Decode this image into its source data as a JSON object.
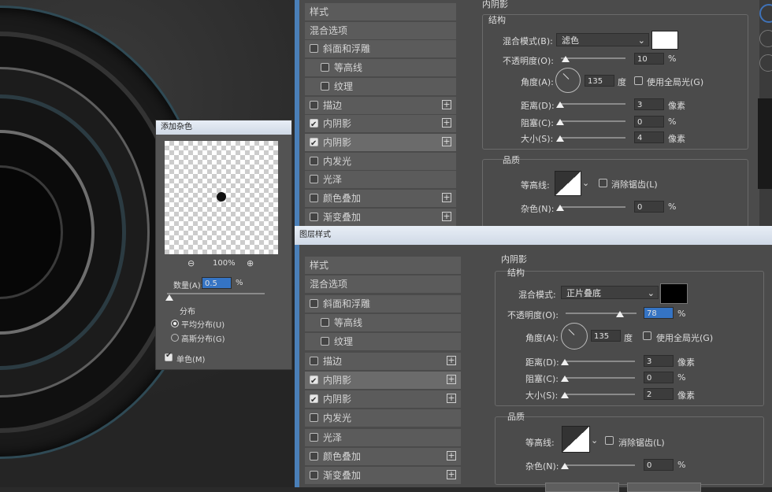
{
  "noise_dialog": {
    "title": "添加杂色",
    "zoom": "100%",
    "amount_label": "数量(A):",
    "amount_value": "0.5",
    "amount_unit": "%",
    "distribution_label": "分布",
    "uniform_label": "平均分布(U)",
    "gaussian_label": "高斯分布(G)",
    "mono_label": "单色(M)",
    "zoom_out": "⊖",
    "zoom_in": "⊕"
  },
  "top_panel": {
    "list": [
      {
        "label": "样式",
        "check": false,
        "checked": false,
        "plus": false,
        "indent": 0
      },
      {
        "label": "混合选项",
        "check": false,
        "checked": false,
        "plus": false,
        "indent": 0
      },
      {
        "label": "斜面和浮雕",
        "check": true,
        "checked": false,
        "plus": false,
        "indent": 0
      },
      {
        "label": "等高线",
        "check": true,
        "checked": false,
        "plus": false,
        "indent": 1
      },
      {
        "label": "纹理",
        "check": true,
        "checked": false,
        "plus": false,
        "indent": 1
      },
      {
        "label": "描边",
        "check": true,
        "checked": false,
        "plus": true,
        "indent": 0
      },
      {
        "label": "内阴影",
        "check": true,
        "checked": true,
        "plus": true,
        "indent": 0
      },
      {
        "label": "内阴影",
        "check": true,
        "checked": true,
        "plus": true,
        "indent": 0,
        "highlight": true
      },
      {
        "label": "内发光",
        "check": true,
        "checked": false,
        "plus": false,
        "indent": 0
      },
      {
        "label": "光泽",
        "check": true,
        "checked": false,
        "plus": false,
        "indent": 0
      },
      {
        "label": "颜色叠加",
        "check": true,
        "checked": false,
        "plus": true,
        "indent": 0
      },
      {
        "label": "渐变叠加",
        "check": true,
        "checked": false,
        "plus": true,
        "indent": 0
      }
    ],
    "section_title": "内阴影",
    "structure": "结构",
    "blend_label": "混合模式(B):",
    "blend_value": "滤色",
    "opacity_label": "不透明度(O):",
    "opacity_value": "10",
    "angle_label": "角度(A):",
    "angle_value": "135",
    "degree": "度",
    "global_light": "使用全局光(G)",
    "distance_label": "距离(D):",
    "distance_value": "3",
    "choke_label": "阻塞(C):",
    "choke_value": "0",
    "size_label": "大小(S):",
    "size_value": "4",
    "quality": "品质",
    "contour_label": "等高线:",
    "antialias": "消除锯齿(L)",
    "noise_label": "杂色(N):",
    "noise_value": "0",
    "pct": "%",
    "px": "像素",
    "blend_color": "#ffffff"
  },
  "bottom_panel": {
    "title": "图层样式",
    "list": [
      {
        "label": "样式",
        "check": false,
        "checked": false,
        "plus": false,
        "indent": 0
      },
      {
        "label": "混合选项",
        "check": false,
        "checked": false,
        "plus": false,
        "indent": 0
      },
      {
        "label": "斜面和浮雕",
        "check": true,
        "checked": false,
        "plus": false,
        "indent": 0
      },
      {
        "label": "等高线",
        "check": true,
        "checked": false,
        "plus": false,
        "indent": 1
      },
      {
        "label": "纹理",
        "check": true,
        "checked": false,
        "plus": false,
        "indent": 1
      },
      {
        "label": "描边",
        "check": true,
        "checked": false,
        "plus": true,
        "indent": 0
      },
      {
        "label": "内阴影",
        "check": true,
        "checked": true,
        "plus": true,
        "indent": 0,
        "highlight": true
      },
      {
        "label": "内阴影",
        "check": true,
        "checked": true,
        "plus": true,
        "indent": 0
      },
      {
        "label": "内发光",
        "check": true,
        "checked": false,
        "plus": false,
        "indent": 0
      },
      {
        "label": "光泽",
        "check": true,
        "checked": false,
        "plus": false,
        "indent": 0
      },
      {
        "label": "颜色叠加",
        "check": true,
        "checked": false,
        "plus": true,
        "indent": 0
      },
      {
        "label": "渐变叠加",
        "check": true,
        "checked": false,
        "plus": true,
        "indent": 0
      }
    ],
    "section_title": "内阴影",
    "structure": "结构",
    "blend_label": "混合模式:",
    "blend_value": "正片叠底",
    "opacity_label": "不透明度(O):",
    "opacity_value": "78",
    "angle_label": "角度(A):",
    "angle_value": "135",
    "degree": "度",
    "global_light": "使用全局光(G)",
    "distance_label": "距离(D):",
    "distance_value": "3",
    "choke_label": "阻塞(C):",
    "choke_value": "0",
    "size_label": "大小(S):",
    "size_value": "2",
    "quality": "品质",
    "contour_label": "等高线:",
    "antialias": "消除锯齿(L)",
    "noise_label": "杂色(N):",
    "noise_value": "0",
    "pct": "%",
    "px": "像素",
    "blend_color": "#000000"
  }
}
